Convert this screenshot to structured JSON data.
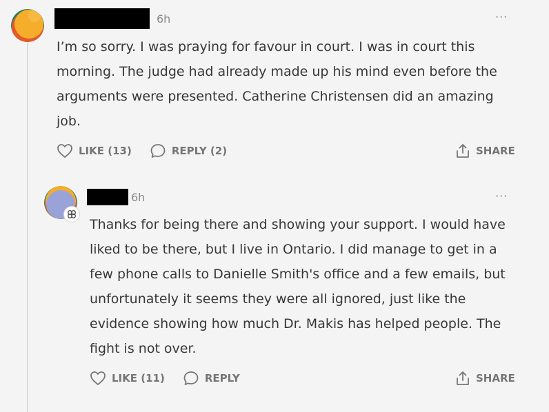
{
  "comments": [
    {
      "time": "6h",
      "menu": "···",
      "text": "I’m so sorry. I was praying for favour in court. I was in court this morning. The judge had already made up his mind even before the arguments were presented. Catherine Christensen did an amazing job.",
      "like_label": "LIKE (13)",
      "reply_label": "REPLY (2)",
      "share_label": "SHARE"
    },
    {
      "time": "6h",
      "menu": "···",
      "text": "Thanks for being there and showing your support. I would have liked to be there, but I live in Ontario. I did manage to get in a few phone calls to Danielle Smith's office and a few emails, but unfortunately it seems they were all ignored, just like the evidence showing how much Dr. Makis has helped people. The fight is not over.",
      "like_label": "LIKE (11)",
      "reply_label": "REPLY",
      "share_label": "SHARE"
    }
  ],
  "icons": {
    "heart": "heart-icon",
    "reply": "speech-bubble-icon",
    "share": "share-icon",
    "more": "ellipsis-icon",
    "badge": "founding-badge-icon"
  },
  "colors": {
    "background": "#f4f4f4",
    "text": "#363737",
    "muted": "#757575",
    "avatar1_main": "#f6ad2b",
    "avatar2_main": "#9aa3d8"
  }
}
